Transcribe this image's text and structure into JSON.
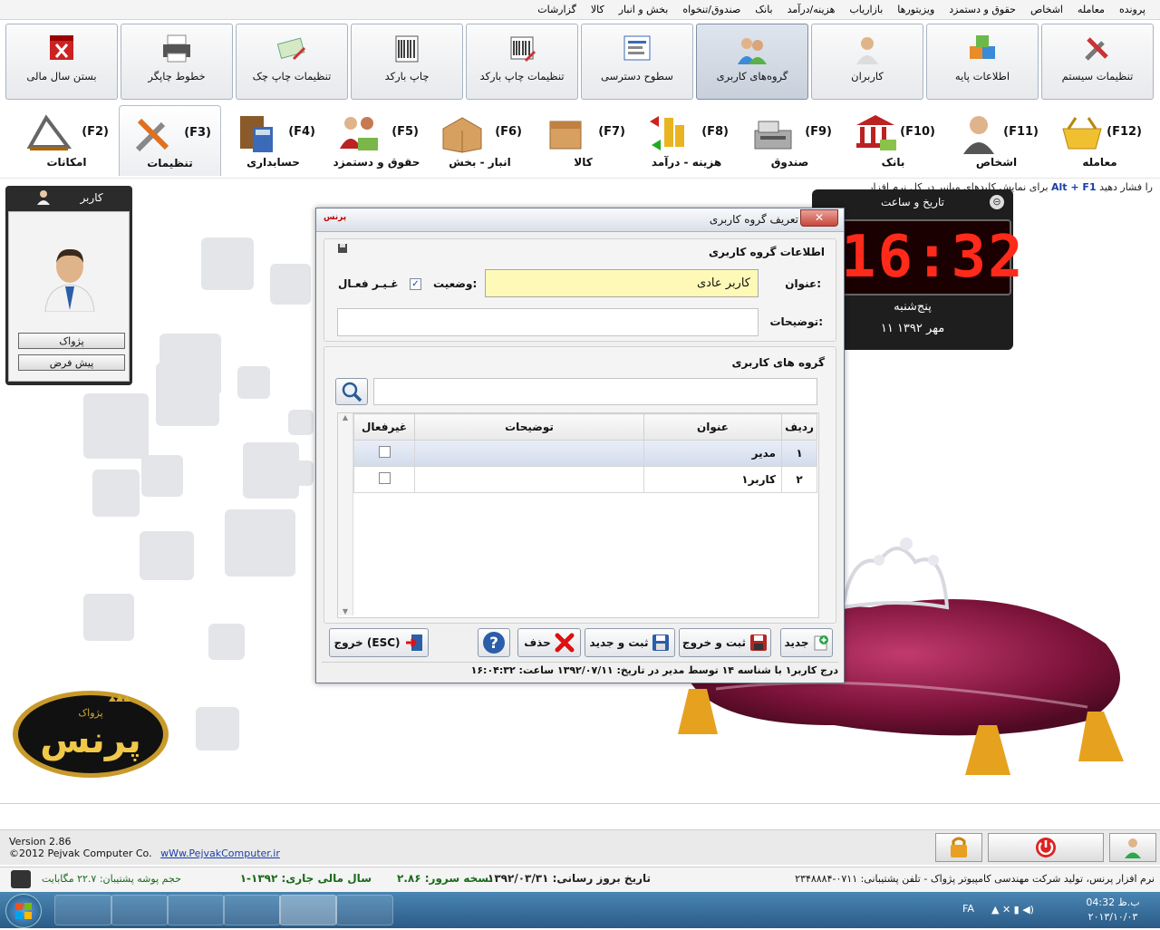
{
  "menu": [
    "پرونده",
    "معامله",
    "اشخاص",
    "حقوق و دستمزد",
    "ویزیتورها",
    "بازاریاب",
    "هزینه/درآمد",
    "بانک",
    "صندوق/تنخواه",
    "بخش و انبار",
    "کالا",
    "گزارشات"
  ],
  "toolbar1": [
    {
      "label": "تنظیمات سیستم",
      "icon": "tools-icon"
    },
    {
      "label": "اطلاعات پایه",
      "icon": "boxes-icon"
    },
    {
      "label": "کاربران",
      "icon": "user-icon"
    },
    {
      "label": "گروه‌های کاربری",
      "icon": "user-group-icon"
    },
    {
      "label": "سطوح دسترسی",
      "icon": "access-levels-icon"
    },
    {
      "label": "تنظیمات چاپ بارکد",
      "icon": "barcode-settings-icon"
    },
    {
      "label": "چاپ بارکد",
      "icon": "barcode-icon"
    },
    {
      "label": "تنظیمات چاپ چک",
      "icon": "check-print-icon"
    },
    {
      "label": "خطوط چاپگر",
      "icon": "printer-icon"
    },
    {
      "label": "بستن سال مالی",
      "icon": "close-year-icon"
    }
  ],
  "toolbar2": [
    {
      "key": "(F12)",
      "label": "معامله",
      "icon": "basket-icon"
    },
    {
      "key": "(F11)",
      "label": "اشخاص",
      "icon": "person-icon"
    },
    {
      "key": "(F10)",
      "label": "بانک",
      "icon": "bank-icon"
    },
    {
      "key": "(F9)",
      "label": "صندوق",
      "icon": "cash-register-icon"
    },
    {
      "key": "(F8)",
      "label": "هزینه - درآمد",
      "icon": "coins-icon"
    },
    {
      "key": "(F7)",
      "label": "کالا",
      "icon": "box-icon"
    },
    {
      "key": "(F6)",
      "label": "انبار - بخش",
      "icon": "warehouse-icon"
    },
    {
      "key": "(F5)",
      "label": "حقوق و دستمزد",
      "icon": "salary-icon"
    },
    {
      "key": "(F4)",
      "label": "حسابداری",
      "icon": "calculator-icon"
    },
    {
      "key": "(F3)",
      "label": "تنظیمات",
      "icon": "wrench-icon"
    },
    {
      "key": "(F2)",
      "label": "امکانات",
      "icon": "drafting-icon"
    }
  ],
  "hint": {
    "pre": "برای نمایش کلیدهای میانبر در کل نرم افزار",
    "keys": "Alt + F1",
    "post": "را فشار دهید"
  },
  "user_panel": {
    "title": "کاربر",
    "btn1": "پژواک",
    "btn2": "پیش فرض"
  },
  "clock": {
    "title": "تاریخ و ساعت",
    "time": "16:32",
    "day": "پنج‌شنبه",
    "date": "۱۱ مهر ۱۳۹۲"
  },
  "logo": {
    "small": "پژواک",
    "big": "پرنس"
  },
  "dialog": {
    "title": "تعریف گروه کاربری",
    "app_icon_text": "پرنس",
    "section1": "اطلاعات گروه کاربری",
    "title_label": "عنوان:",
    "title_value": "کاربر عادی",
    "status_label": "وضعیت:",
    "inactive_label": "غـیـر فعـال",
    "desc_label": "توضیحات:",
    "section2": "گروه های کاربری",
    "grid": {
      "headers": [
        "ردیف",
        "عنوان",
        "توضیحات",
        "غیرفعال"
      ],
      "rows": [
        {
          "n": "۱",
          "title": "مدیر",
          "desc": "",
          "inactive": false
        },
        {
          "n": "۲",
          "title": "کاربر۱",
          "desc": "",
          "inactive": false
        }
      ]
    },
    "buttons": {
      "new": "جدید",
      "save_exit": "ثبت و خروج",
      "save_new": "ثبت و جدید",
      "delete": "حذف",
      "exit": "خروج (ESC)"
    },
    "status": "درج کاربر۱ با شناسه ۱۴ توسط مدیر در تاریخ: ۱۳۹۲/۰۷/۱۱ ساعت: ۱۶:۰۴:۳۲"
  },
  "version": {
    "line1": "Version 2.86",
    "line2": "©2012 Pejvak Computer Co.",
    "link": "wWw.PejvakComputer.ir"
  },
  "statusbar": {
    "product": "نرم افزار پرنس، تولید شرکت مهندسی کامپیوتر پژواک - تلفن پشتیبانی: ۰۷۱۱-۲۳۴۸۸۸۴",
    "update": "تاریخ بروز رسانی: ۱۳۹۲/۰۳/۳۱",
    "server": "نسخه سرور: ۲.۸۶",
    "fiscal": "سال مالی جاری: ۱۳۹۲-۱",
    "backup": "حجم پوشه پشتیبان: ۲۲.۷ مگابایت"
  },
  "taskbar": {
    "lang": "FA",
    "time": "04:32 ب.ظ",
    "date": "۲۰۱۳/۱۰/۰۳"
  }
}
